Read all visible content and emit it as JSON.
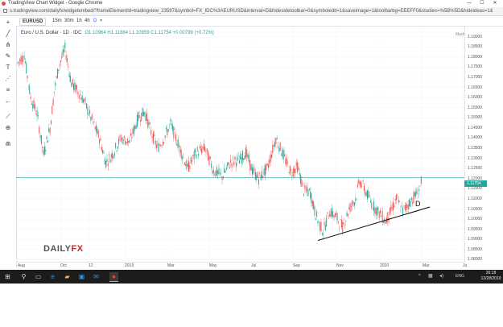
{
  "browser": {
    "title": "TradingView Chart Widget - Google Chrome",
    "url": "s.tradingview.com/dailyfx/widgetembed/?frameElementId=tradingview_23597&symbol=FX_IDC%3AEURUSD&interval=D&hidesidetoolbar=0&symboledit=1&saveimage=1&toolbarbg=EEEFF0&studies=%5B%5D&hideideas=1&theme=Light&timezone=exchange&studies_overrides=%7B%7D",
    "min": "—",
    "max": "☐",
    "close": "✕"
  },
  "toolbar": {
    "symbol": "EURUSD",
    "timeframes": [
      "15m",
      "30m",
      "1h",
      "4h",
      "D"
    ],
    "active_timeframe": "D"
  },
  "legend": {
    "title": "Euro / U.S. Dollar · 1D · IDC",
    "ohlc": "O1.10964 H1.11884 L1.10959 C1.11754 +0.00799 (+0.72%)"
  },
  "market_status": "Market Closed",
  "chart_data": {
    "type": "candlestick",
    "instrument": "EURUSD",
    "y_ticks": [
      "1.19000",
      "1.18500",
      "1.18000",
      "1.17500",
      "1.17000",
      "1.16500",
      "1.16000",
      "1.15500",
      "1.15000",
      "1.14500",
      "1.14000",
      "1.13500",
      "1.13000",
      "1.12500",
      "1.12000",
      "1.11500",
      "1.11000",
      "1.10500",
      "1.10000",
      "1.09500",
      "1.09000",
      "1.08500",
      "1.08000"
    ],
    "ylim": [
      1.079,
      1.195
    ],
    "x_ticks": [
      "Aug",
      "Oct",
      "12",
      "2019",
      "Mar",
      "May",
      "Jul",
      "Sep",
      "Nov",
      "2020",
      "Mar",
      "Ju"
    ],
    "last_price": "1.11754",
    "last_price_value": 1.11754,
    "last_price_color": "#26a69a",
    "up_color": "#26a69a",
    "down_color": "#ef5350",
    "path_anchors": [
      [
        0,
        1.177
      ],
      [
        6,
        1.181
      ],
      [
        12,
        1.16
      ],
      [
        18,
        1.152
      ],
      [
        24,
        1.132
      ],
      [
        30,
        1.145
      ],
      [
        34,
        1.163
      ],
      [
        38,
        1.175
      ],
      [
        44,
        1.184
      ],
      [
        50,
        1.167
      ],
      [
        56,
        1.163
      ],
      [
        62,
        1.158
      ],
      [
        68,
        1.15
      ],
      [
        76,
        1.14
      ],
      [
        82,
        1.128
      ],
      [
        88,
        1.132
      ],
      [
        96,
        1.14
      ],
      [
        104,
        1.138
      ],
      [
        112,
        1.15
      ],
      [
        118,
        1.153
      ],
      [
        124,
        1.143
      ],
      [
        130,
        1.135
      ],
      [
        136,
        1.14
      ],
      [
        142,
        1.147
      ],
      [
        150,
        1.136
      ],
      [
        158,
        1.125
      ],
      [
        166,
        1.133
      ],
      [
        174,
        1.135
      ],
      [
        182,
        1.124
      ],
      [
        190,
        1.121
      ],
      [
        198,
        1.128
      ],
      [
        206,
        1.129
      ],
      [
        212,
        1.133
      ],
      [
        218,
        1.124
      ],
      [
        224,
        1.12
      ],
      [
        232,
        1.125
      ],
      [
        240,
        1.14
      ],
      [
        248,
        1.13
      ],
      [
        254,
        1.123
      ],
      [
        260,
        1.126
      ],
      [
        266,
        1.114
      ],
      [
        272,
        1.113
      ],
      [
        276,
        1.104
      ],
      [
        280,
        1.098
      ],
      [
        284,
        1.094
      ],
      [
        290,
        1.104
      ],
      [
        296,
        1.101
      ],
      [
        302,
        1.096
      ],
      [
        308,
        1.105
      ],
      [
        314,
        1.11
      ],
      [
        318,
        1.119
      ],
      [
        324,
        1.113
      ],
      [
        330,
        1.107
      ],
      [
        336,
        1.103
      ],
      [
        342,
        1.099
      ],
      [
        346,
        1.103
      ],
      [
        352,
        1.11
      ],
      [
        358,
        1.104
      ],
      [
        364,
        1.108
      ],
      [
        368,
        1.111
      ],
      [
        372,
        1.113
      ],
      [
        375,
        1.118
      ]
    ],
    "trendline": {
      "start": [
        279,
        1.0895
      ],
      "end": [
        383,
        1.106
      ]
    },
    "hline_value": 1.1205,
    "trendline_label": "D"
  },
  "logo": {
    "part1": "DAILY",
    "part2": "FX"
  },
  "taskbar": {
    "time": "20:18",
    "date": "12/28/2019",
    "lang": "ENG",
    "icons": [
      "windows-icon",
      "search-icon",
      "task-view-icon",
      "edge-icon",
      "file-explorer-icon",
      "store-icon",
      "mail-icon",
      "chrome-icon"
    ]
  }
}
